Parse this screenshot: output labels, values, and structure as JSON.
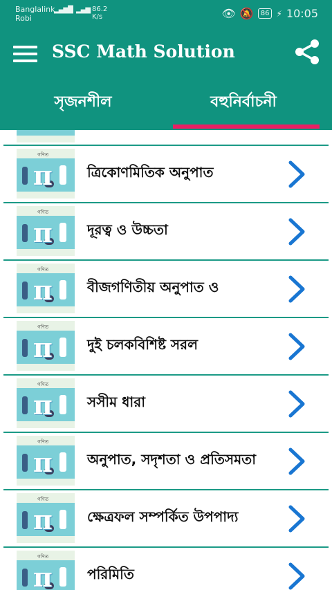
{
  "status_bar": {
    "carrier1": "Banglalink",
    "carrier2": "Robi",
    "net_speed_value": "86.2",
    "net_speed_unit": "K/s",
    "battery": "86",
    "time": "10:05"
  },
  "app_bar": {
    "title": "SSC Math Solution",
    "menu_icon": "hamburger-menu-icon",
    "share_icon": "share-icon"
  },
  "tabs": [
    {
      "label": "সৃজনশীল",
      "selected": false
    },
    {
      "label": "বহুনির্বাচনী",
      "selected": true
    }
  ],
  "colors": {
    "primary": "#10937f",
    "tab_indicator": "#e91e63",
    "chevron": "#1976d2"
  },
  "list": {
    "thumbnail_title": "গণিত",
    "items": [
      {
        "label": "ত্রিকোণমিতিক অনুপাত"
      },
      {
        "label": "দূরত্ব ও উচ্চতা"
      },
      {
        "label": "বীজগণিতীয় অনুপাত ও"
      },
      {
        "label": "দুই চলকবিশিষ্ট সরল"
      },
      {
        "label": "সসীম ধারা"
      },
      {
        "label": "অনুপাত, সদৃশতা ও প্রতিসমতা"
      },
      {
        "label": "ক্ষেত্রফল সম্পর্কিত উপপাদ্য"
      },
      {
        "label": "পরিমিতি"
      }
    ]
  }
}
